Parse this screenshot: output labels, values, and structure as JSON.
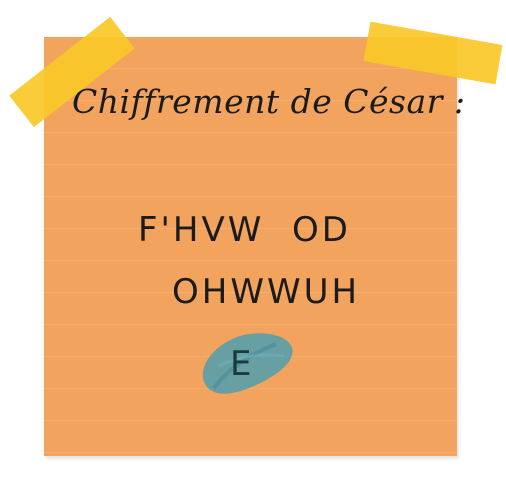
{
  "note": {
    "title": "Chiffrement de César :",
    "cipher_lines": [
      "F'HVW  OD",
      "OHWWUH"
    ],
    "answer": "E",
    "colors": {
      "paper": "#f2a35d",
      "tape": "#fac828",
      "smudge": "#4f9fae",
      "ink": "#1b1b1b"
    }
  }
}
